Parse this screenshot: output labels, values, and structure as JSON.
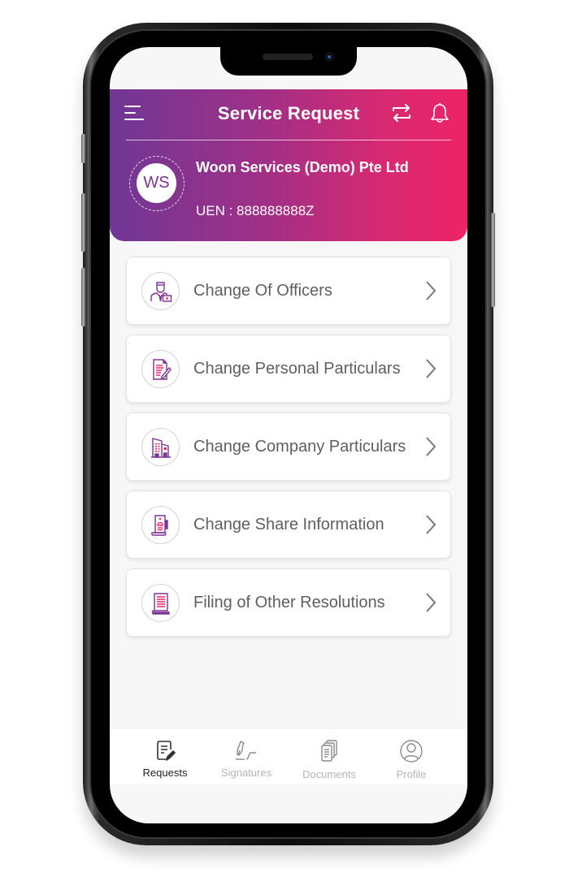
{
  "header": {
    "title": "Service Request",
    "menu_icon": "hamburger-menu-icon",
    "switch_icon": "switch-arrows-icon",
    "notification_icon": "bell-icon",
    "gradient_start": "#6f3795",
    "gradient_end": "#ee2266"
  },
  "company": {
    "initials": "WS",
    "name": "Woon Services (Demo) Pte Ltd",
    "uen": "UEN : 888888888Z"
  },
  "services": [
    {
      "label": "Change Of Officers",
      "icon": "officer-icon"
    },
    {
      "label": "Change Personal Particulars",
      "icon": "document-edit-icon"
    },
    {
      "label": "Change Company Particulars",
      "icon": "building-icon"
    },
    {
      "label": "Change Share Information",
      "icon": "share-certificate-icon"
    },
    {
      "label": "Filing of Other Resolutions",
      "icon": "resolution-scroll-icon"
    }
  ],
  "bottom_nav": {
    "items": [
      {
        "label": "Requests",
        "icon": "requests-icon",
        "active": true
      },
      {
        "label": "Signatures",
        "icon": "signature-pen-icon",
        "active": false
      },
      {
        "label": "Documents",
        "icon": "documents-icon",
        "active": false
      },
      {
        "label": "Profile",
        "icon": "profile-icon",
        "active": false
      }
    ]
  },
  "colors": {
    "accent_purple": "#7b3592",
    "accent_pink": "#ee2266",
    "text_muted": "#b5b5b5"
  }
}
